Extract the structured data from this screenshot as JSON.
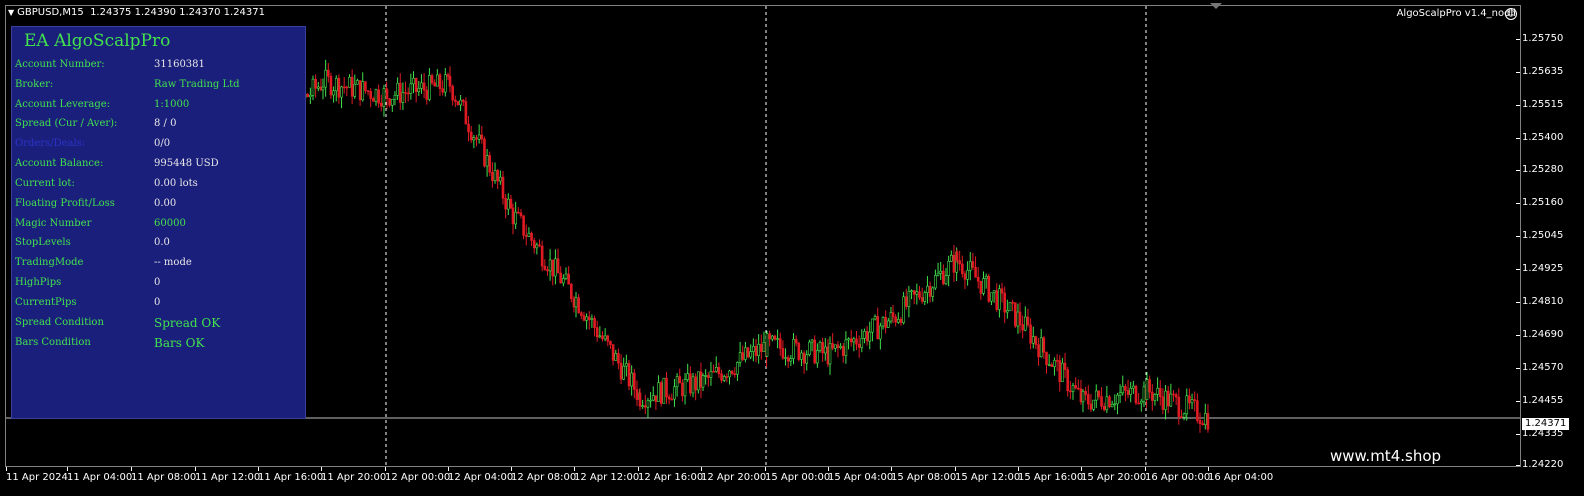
{
  "symbol_bar": {
    "symbol": "GBPUSD,M15",
    "ohlc": "1.24375 1.24390 1.24370 1.24371"
  },
  "ea_title": "AlgoScalpPro v1.4_nodll",
  "watermark": "www.mt4.shop",
  "colors": {
    "background": "#000000",
    "bull": "#41e24d",
    "bear": "#e01b24",
    "panel": "#1b1f7c",
    "panel_text": "#41e24d"
  },
  "panel": {
    "title": "EA AlgoScalpPro",
    "rows": [
      {
        "label": "Account Number:",
        "value": "31160381"
      },
      {
        "label": "Broker:",
        "value": "Raw Trading Ltd"
      },
      {
        "label": "Account Leverage:",
        "value": "1:1000"
      },
      {
        "label": "Spread (Cur / Aver):",
        "value": "8 / 0"
      },
      {
        "label": "Orders/Deals:",
        "value": "0/0"
      },
      {
        "label": "Account Balance:",
        "value": "995448 USD"
      },
      {
        "label": "Current lot:",
        "value": "0.00 lots"
      },
      {
        "label": "Floating Profit/Loss",
        "value": "0.00"
      },
      {
        "label": "Magic Number",
        "value": "60000"
      },
      {
        "label": "StopLevels",
        "value": "0.0"
      },
      {
        "label": "TradingMode",
        "value": " -- mode"
      },
      {
        "label": "HighPips",
        "value": "0"
      },
      {
        "label": "CurrentPips",
        "value": "0"
      },
      {
        "label": " Spread Condition",
        "value": "Spread OK"
      },
      {
        "label": " Bars Condition",
        "value": "Bars OK"
      }
    ]
  },
  "price_axis": {
    "ticks": [
      "1.25750",
      "1.25635",
      "1.25515",
      "1.25400",
      "1.25280",
      "1.25160",
      "1.25045",
      "1.24925",
      "1.24810",
      "1.24690",
      "1.24570",
      "1.24455",
      "1.24335",
      "1.24220"
    ],
    "current_price": "1.24371"
  },
  "time_axis": {
    "ticks": [
      "11 Apr 2024",
      "11 Apr 04:00",
      "11 Apr 08:00",
      "11 Apr 12:00",
      "11 Apr 16:00",
      "11 Apr 20:00",
      "12 Apr 00:00",
      "12 Apr 04:00",
      "12 Apr 08:00",
      "12 Apr 12:00",
      "12 Apr 16:00",
      "12 Apr 20:00",
      "15 Apr 00:00",
      "15 Apr 04:00",
      "15 Apr 08:00",
      "15 Apr 12:00",
      "15 Apr 16:00",
      "15 Apr 20:00",
      "16 Apr 00:00",
      "16 Apr 04:00"
    ]
  },
  "chart_data": {
    "type": "candlestick",
    "symbol": "GBPUSD",
    "timeframe": "M15",
    "ylim": [
      1.2422,
      1.2575
    ],
    "day_separators": [
      "12 Apr 00:00",
      "15 Apr 00:00",
      "16 Apr 00:00"
    ],
    "close_path": [
      {
        "x": "11 Apr 16:00",
        "close": 1.2537
      },
      {
        "x": "11 Apr 20:00",
        "close": 1.2558
      },
      {
        "x": "12 Apr 00:00",
        "close": 1.2553
      },
      {
        "x": "12 Apr 04:00",
        "close": 1.2557
      },
      {
        "x": "12 Apr 08:00",
        "close": 1.251
      },
      {
        "x": "12 Apr 12:00",
        "close": 1.248
      },
      {
        "x": "12 Apr 16:00",
        "close": 1.2445
      },
      {
        "x": "12 Apr 20:00",
        "close": 1.245
      },
      {
        "x": "15 Apr 00:00",
        "close": 1.2463
      },
      {
        "x": "15 Apr 04:00",
        "close": 1.246
      },
      {
        "x": "15 Apr 08:00",
        "close": 1.2473
      },
      {
        "x": "15 Apr 12:00",
        "close": 1.2494
      },
      {
        "x": "15 Apr 16:00",
        "close": 1.2472
      },
      {
        "x": "15 Apr 20:00",
        "close": 1.2443
      },
      {
        "x": "16 Apr 00:00",
        "close": 1.2447
      },
      {
        "x": "16 Apr 04:00",
        "close": 1.2437
      }
    ]
  }
}
